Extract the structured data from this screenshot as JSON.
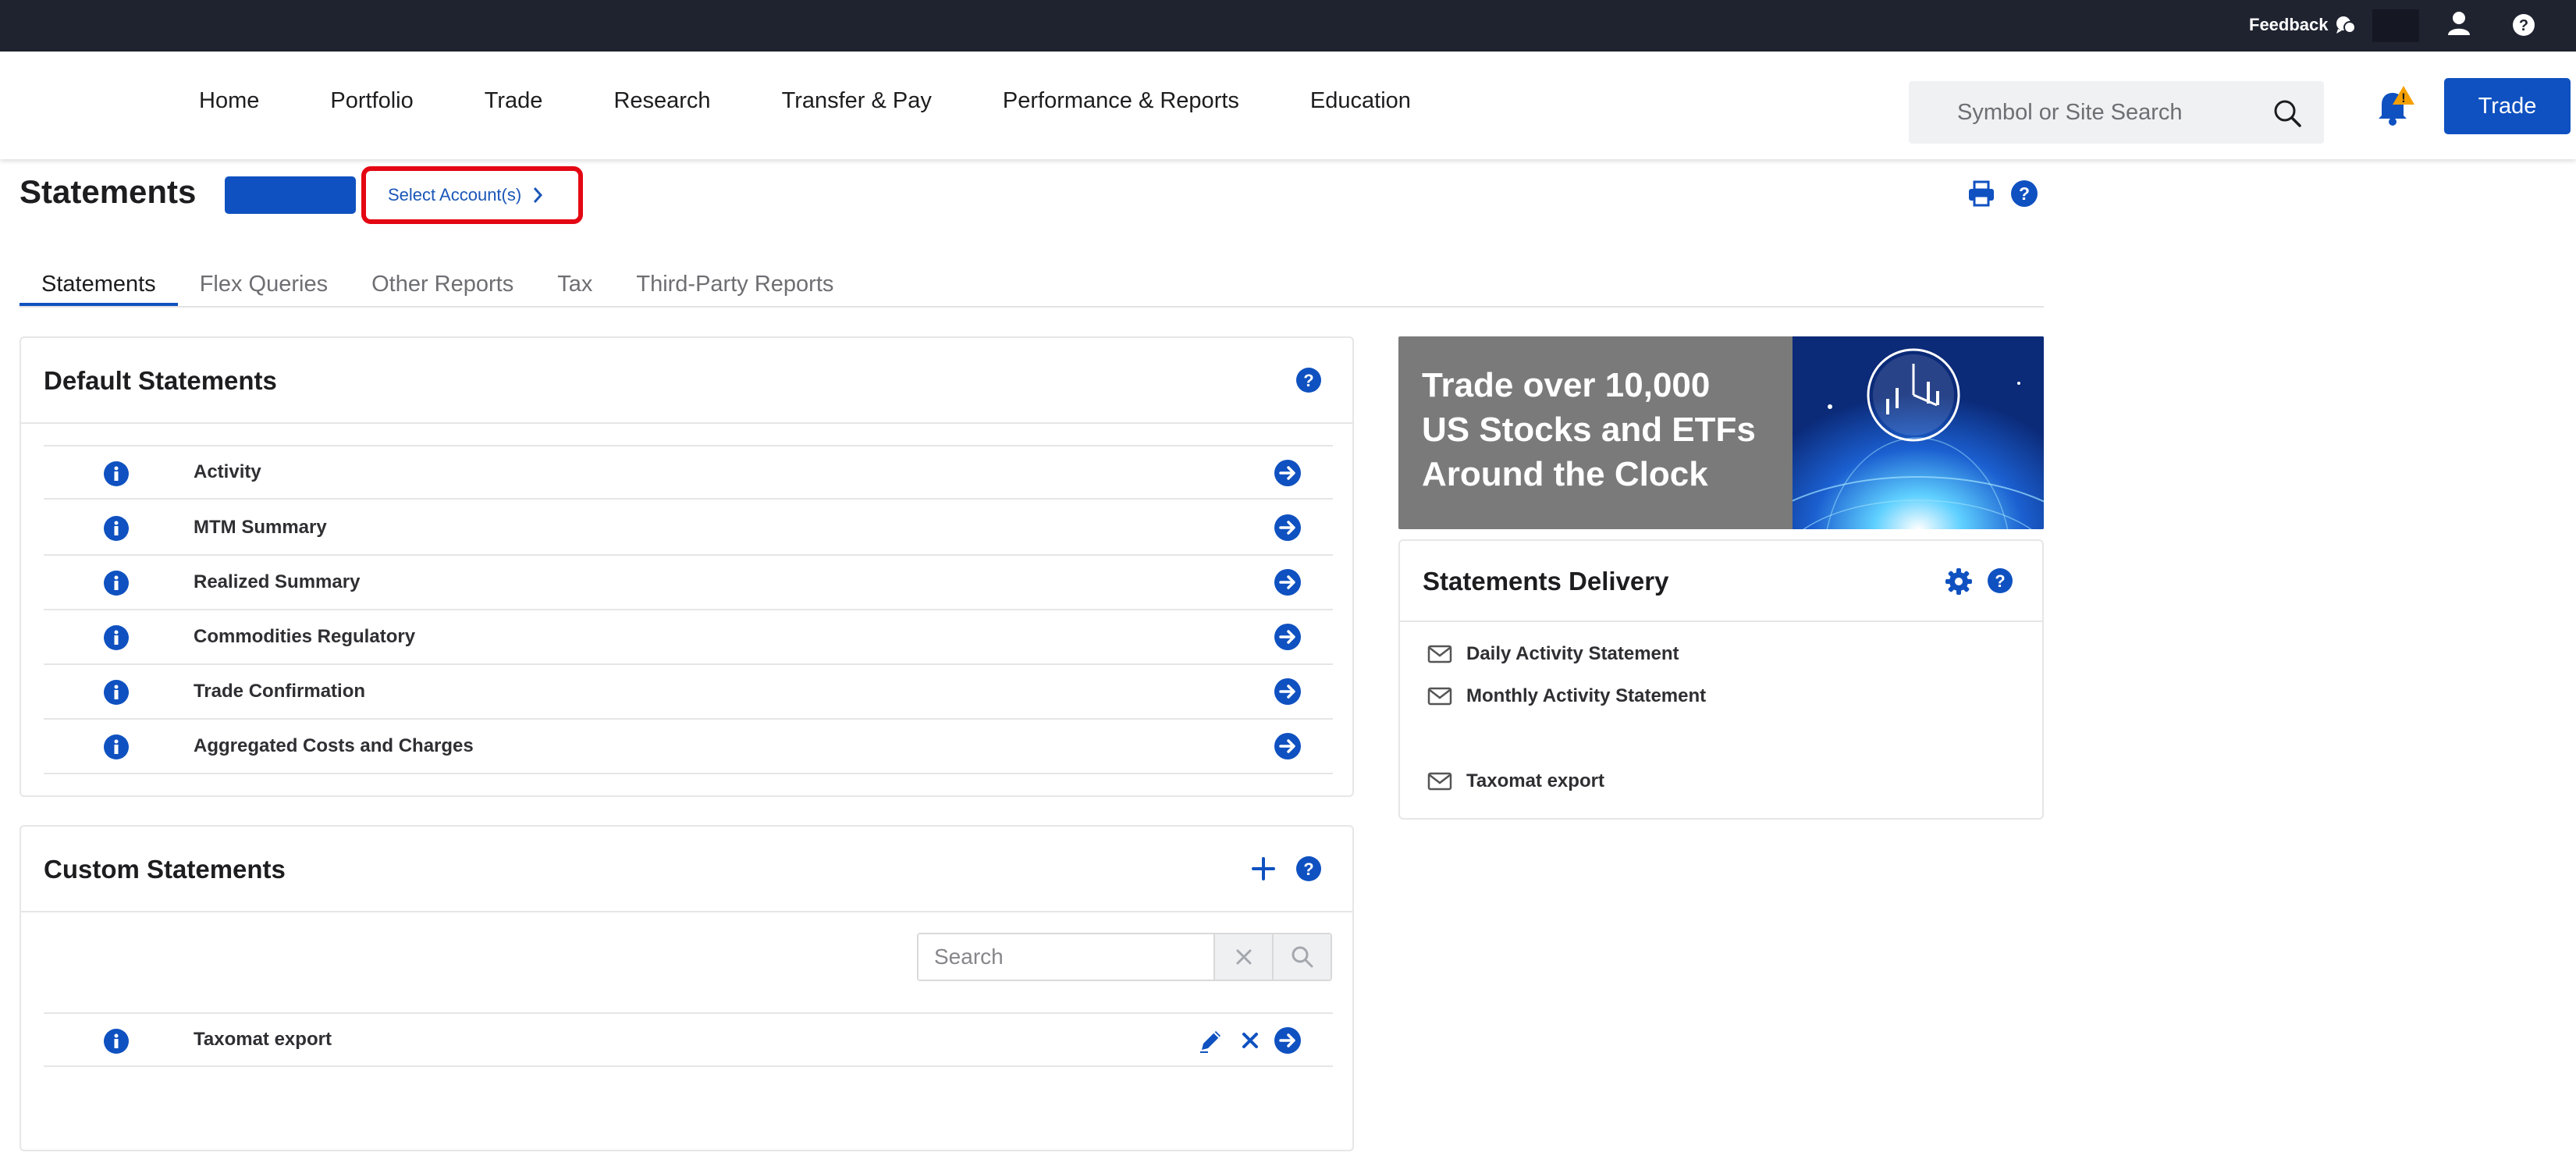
{
  "topbar": {
    "feedback_label": "Feedback"
  },
  "nav": {
    "items": [
      "Home",
      "Portfolio",
      "Trade",
      "Research",
      "Transfer & Pay",
      "Performance & Reports",
      "Education"
    ],
    "search_placeholder": "Symbol or Site Search",
    "notification_badge": "!",
    "trade_button": "Trade"
  },
  "page": {
    "title": "Statements",
    "select_accounts_label": "Select Account(s)"
  },
  "tabs": [
    "Statements",
    "Flex Queries",
    "Other Reports",
    "Tax",
    "Third-Party Reports"
  ],
  "default_statements": {
    "title": "Default Statements",
    "items": [
      "Activity",
      "MTM Summary",
      "Realized Summary",
      "Commodities Regulatory",
      "Trade Confirmation",
      "Aggregated Costs and Charges"
    ]
  },
  "custom_statements": {
    "title": "Custom Statements",
    "search_placeholder": "Search",
    "items": [
      "Taxomat export"
    ]
  },
  "promo": {
    "line1": "Trade over 10,000",
    "line2": "US Stocks and ETFs",
    "line3": "Around the Clock"
  },
  "delivery": {
    "title": "Statements Delivery",
    "items": [
      "Daily Activity Statement",
      "Monthly Activity Statement",
      "Taxomat export"
    ]
  },
  "colors": {
    "brand_blue": "#0f51c0",
    "highlight_red": "#e40613",
    "topbar": "#1f2330"
  }
}
